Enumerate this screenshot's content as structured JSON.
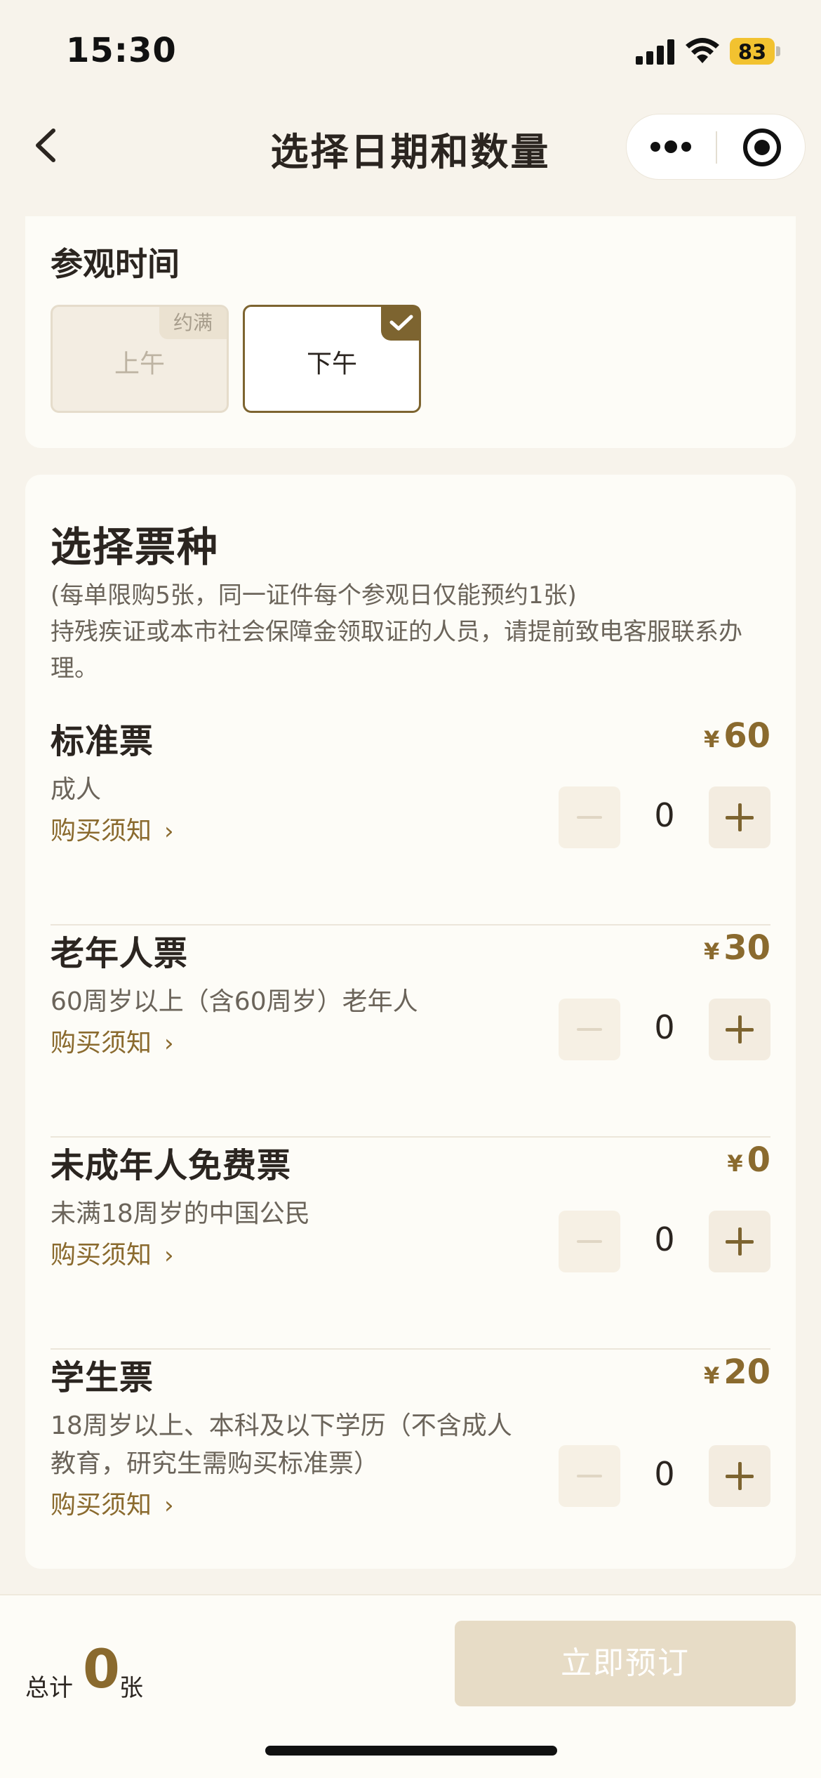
{
  "status_bar": {
    "time": "15:30",
    "battery": "83"
  },
  "nav": {
    "title": "选择日期和数量"
  },
  "visit_time": {
    "title": "参观时间",
    "slots": [
      {
        "label": "上午",
        "badge": "约满",
        "state": "full"
      },
      {
        "label": "下午",
        "state": "selected"
      }
    ]
  },
  "tickets_section": {
    "title": "选择票种",
    "notice": "(每单限购5张，同一证件每个参观日仅能预约1张)\n持残疾证或本市社会保障金领取证的人员，请提前致电客服联系办理。"
  },
  "currency": "¥",
  "link_label": "购买须知",
  "tickets": [
    {
      "name": "标准票",
      "price": "60",
      "desc": "成人",
      "quantity": "0"
    },
    {
      "name": "老年人票",
      "price": "30",
      "desc": "60周岁以上（含60周岁）老年人",
      "quantity": "0"
    },
    {
      "name": "未成年人免费票",
      "price": "0",
      "desc": "未满18周岁的中国公民",
      "quantity": "0"
    },
    {
      "name": "学生票",
      "price": "20",
      "desc": "18周岁以上、本科及以下学历（不含成人教育，研究生需购买标准票）",
      "quantity": "0"
    }
  ],
  "footer": {
    "total_label": "总计",
    "total_count": "0",
    "total_unit": "张",
    "book_label": "立即预订"
  },
  "colors": {
    "accent": "#7d6430",
    "price": "#8a6a2e",
    "background": "#f7f3eb",
    "card": "#fdfcf7",
    "button_disabled": "#e7dcc6"
  }
}
